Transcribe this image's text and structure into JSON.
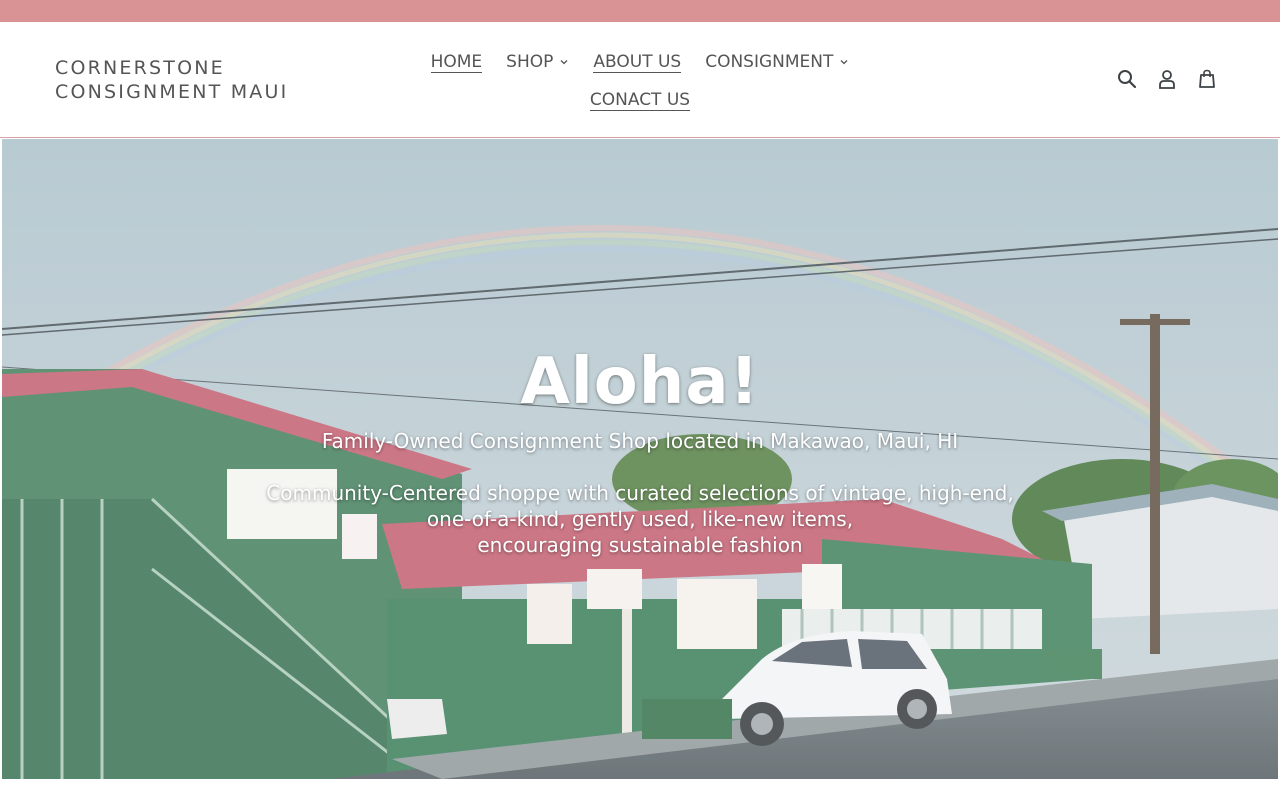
{
  "announcement": {
    "color": "#d99394"
  },
  "header": {
    "logo_line1": "CORNERSTONE",
    "logo_line2": "CONSIGNMENT MAUI",
    "nav": [
      {
        "label": "HOME",
        "active": true,
        "has_dropdown": false
      },
      {
        "label": "SHOP",
        "active": false,
        "has_dropdown": true
      },
      {
        "label": "ABOUT US",
        "active": true,
        "has_dropdown": false
      },
      {
        "label": "CONSIGNMENT",
        "active": false,
        "has_dropdown": true
      },
      {
        "label": "CONACT US",
        "active": true,
        "has_dropdown": false
      }
    ],
    "icons": [
      "search-icon",
      "account-icon",
      "cart-icon"
    ]
  },
  "hero": {
    "title": "Aloha!",
    "subtitle": "Family-Owned Consignment Shop located in Makawao, Maui, HI",
    "description_lines": [
      "Community-Centered shoppe with curated selections of vintage, high-end,",
      "one-of-a-kind, gently used, like-new items,",
      "encouraging sustainable fashion"
    ]
  },
  "colors": {
    "accent": "#d99394",
    "text": "#555555",
    "hero_text": "#ffffff"
  }
}
